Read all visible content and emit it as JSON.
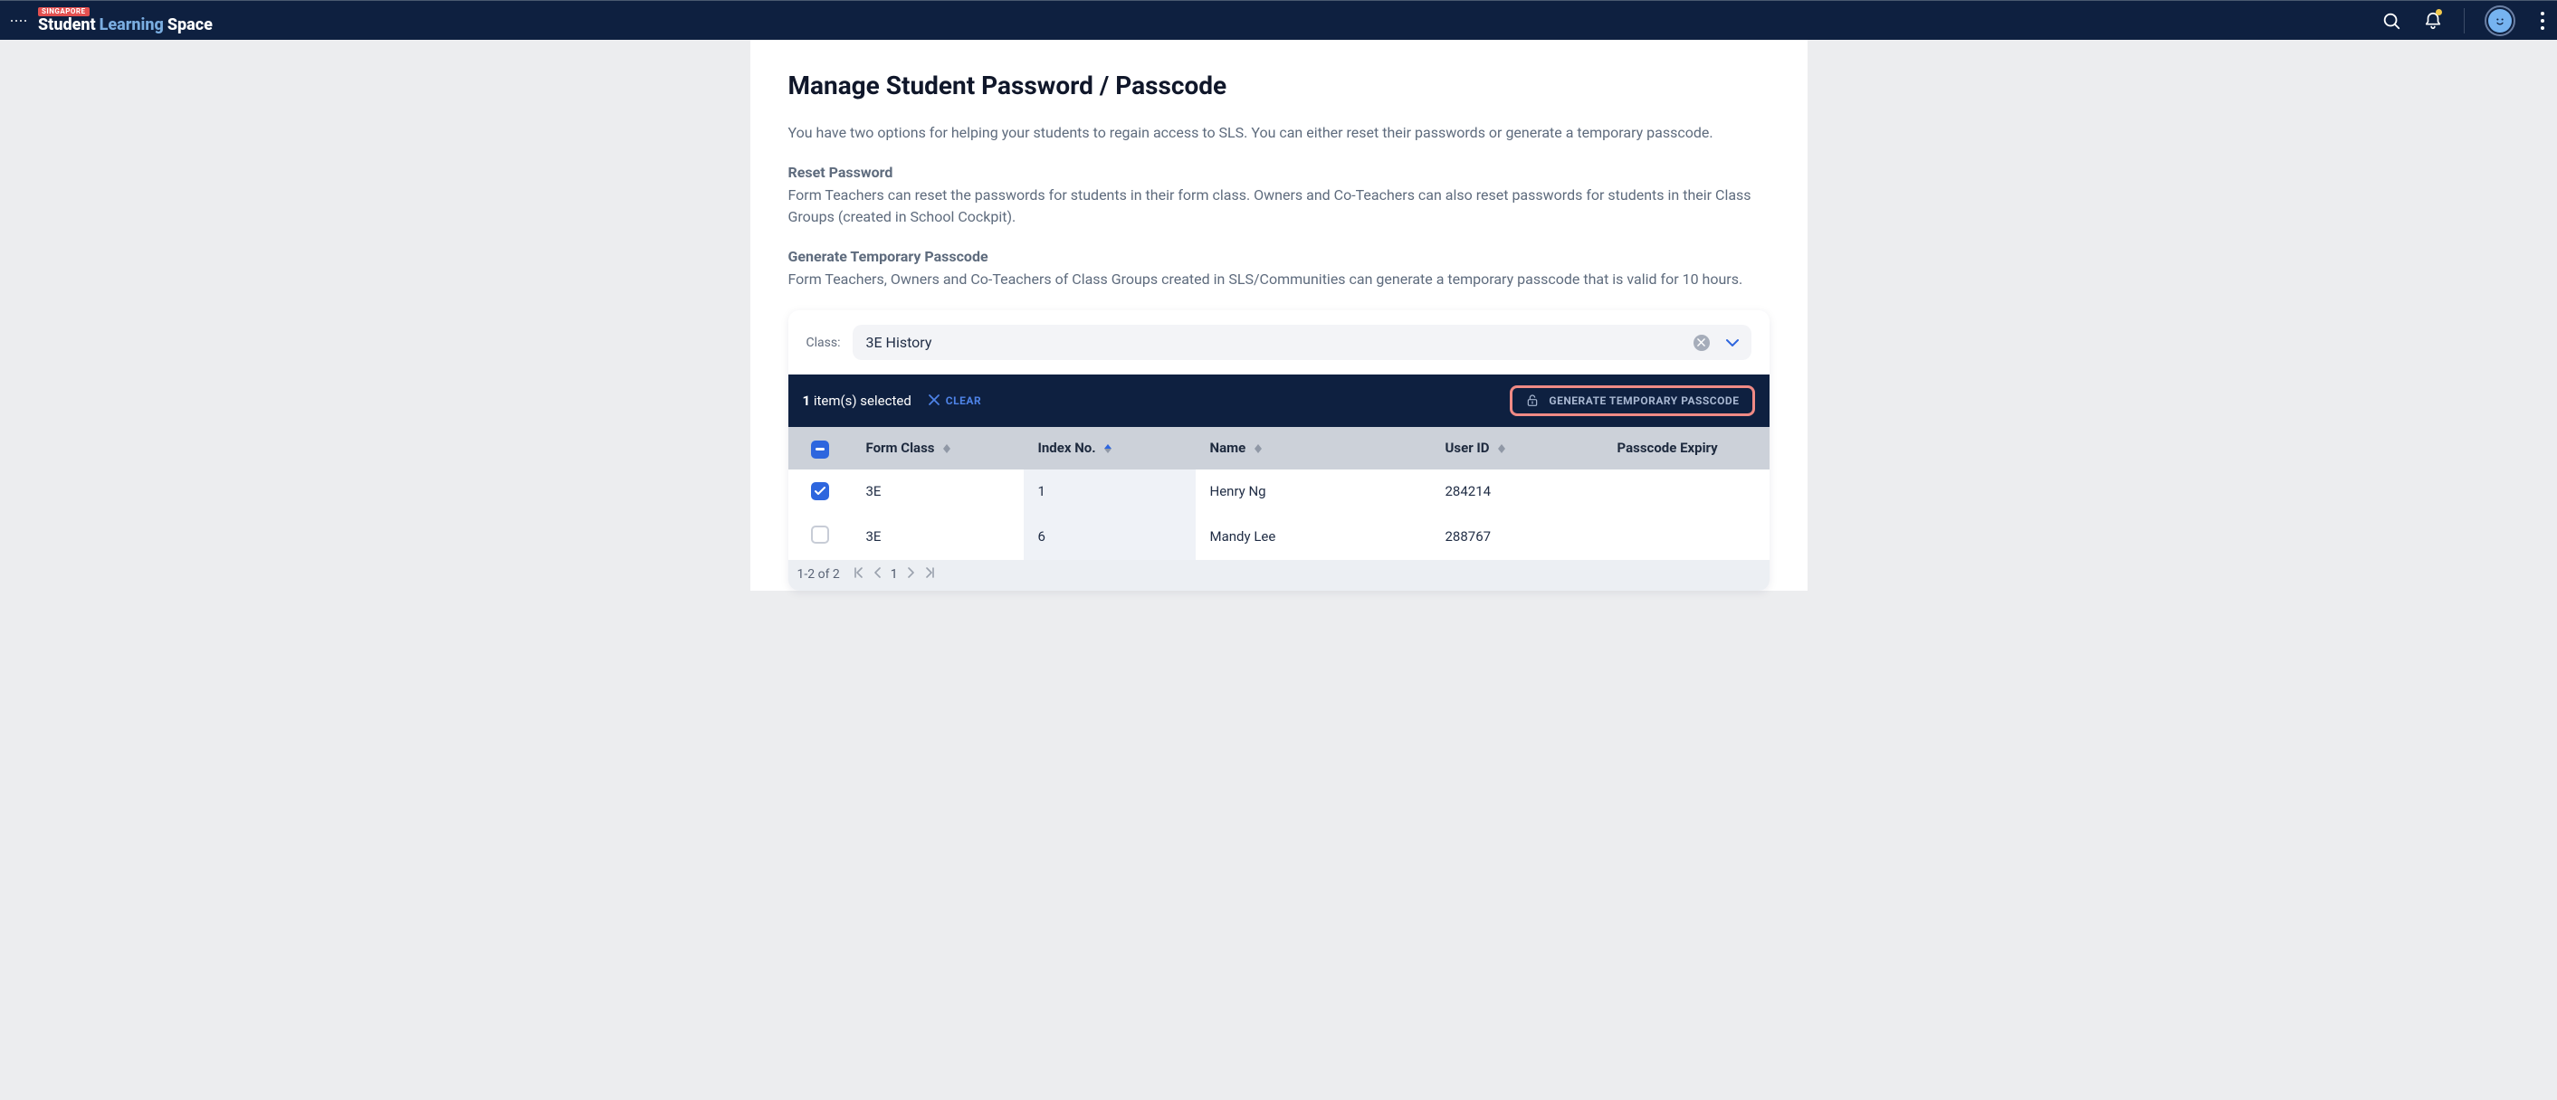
{
  "brand": {
    "badge": "SINGAPORE",
    "p1": "Student",
    "p2": "Learning",
    "p3": "Space"
  },
  "page": {
    "title": "Manage Student Password / Passcode",
    "intro": "You have two options for helping your students to regain access to SLS. You can either reset their passwords or generate a temporary passcode.",
    "reset_title": "Reset Password",
    "reset_text": "Form Teachers can reset the passwords for students in their form class. Owners and Co-Teachers can also reset passwords for students in their Class Groups (created in School Cockpit).",
    "gen_title": "Generate Temporary Passcode",
    "gen_text": "Form Teachers, Owners and Co-Teachers of Class Groups created in SLS/Communities can generate a temporary passcode that is valid for 10 hours."
  },
  "filter": {
    "label": "Class:",
    "value": "3E History"
  },
  "selection": {
    "count_prefix": "1",
    "count_rest": " item(s) selected",
    "clear": "CLEAR",
    "generate": "GENERATE TEMPORARY PASSCODE"
  },
  "table": {
    "headers": {
      "form_class": "Form Class",
      "index_no": "Index No.",
      "name": "Name",
      "user_id": "User ID",
      "passcode_expiry": "Passcode Expiry"
    },
    "rows": [
      {
        "checked": true,
        "form_class": "3E",
        "index_no": "1",
        "name": "Henry Ng",
        "user_id": "284214",
        "passcode_expiry": ""
      },
      {
        "checked": false,
        "form_class": "3E",
        "index_no": "6",
        "name": "Mandy Lee",
        "user_id": "288767",
        "passcode_expiry": ""
      }
    ]
  },
  "pager": {
    "range": "1-2 of 2",
    "page": "1"
  }
}
